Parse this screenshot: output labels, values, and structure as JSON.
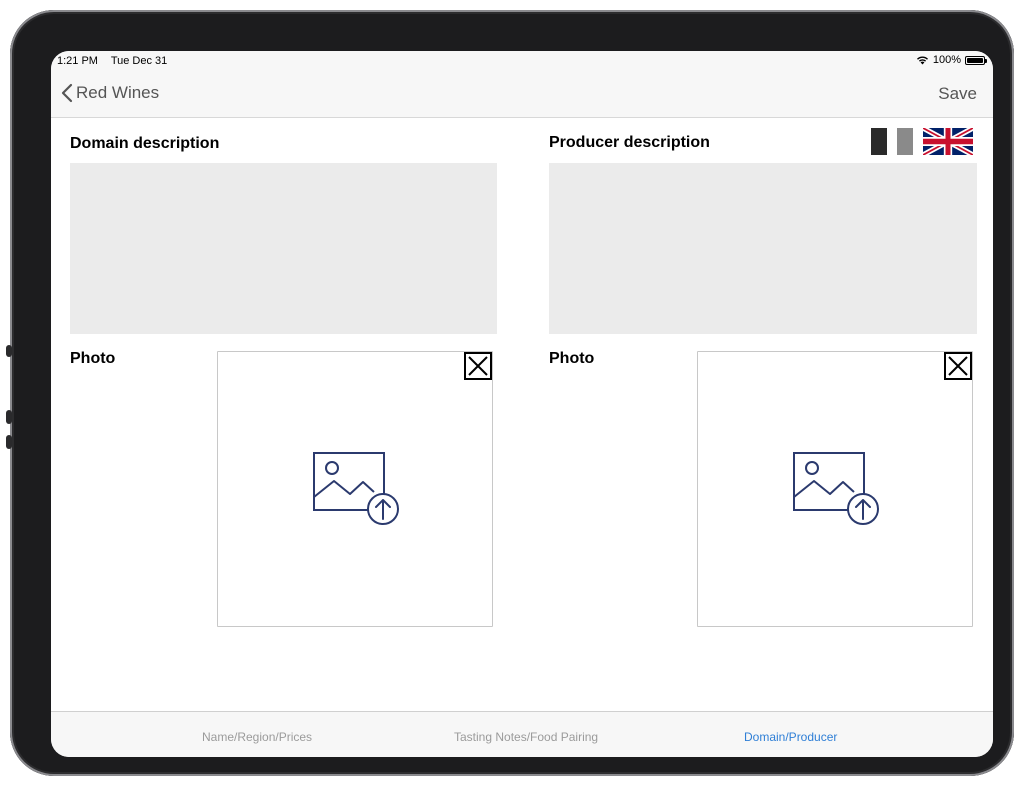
{
  "status_bar": {
    "time": "1:21 PM",
    "date": "Tue Dec 31",
    "battery": "100%",
    "battery_level": 1.0
  },
  "nav": {
    "back_label": "Red Wines",
    "save_label": "Save"
  },
  "domain": {
    "title": "Domain description",
    "description": "",
    "photo_label": "Photo"
  },
  "producer": {
    "title": "Producer description",
    "description": "",
    "photo_label": "Photo"
  },
  "languages": [
    {
      "icon": "flag-dark-icon",
      "color": "#2b2b2b"
    },
    {
      "icon": "flag-gray-icon",
      "color": "#8a8a8a"
    },
    {
      "icon": "uk-flag-icon",
      "color": "#012169"
    }
  ],
  "tabs": [
    {
      "label": "Name/Region/Prices",
      "active": false
    },
    {
      "label": "Tasting Notes/Food Pairing",
      "active": false
    },
    {
      "label": "Domain/Producer",
      "active": true
    }
  ],
  "colors": {
    "accent": "#2f7fd6",
    "icon": "#2b3a6e",
    "field": "#ebebeb"
  }
}
